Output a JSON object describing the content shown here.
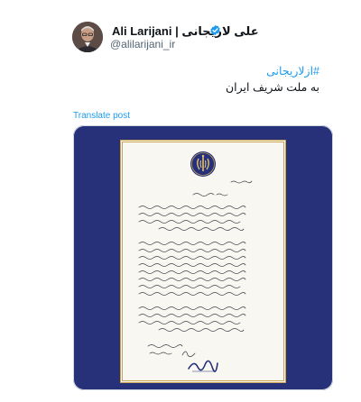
{
  "post": {
    "author": {
      "display_name": "Ali Larijani | علی لاریجانی",
      "handle": "@alilarijani_ir",
      "verified": true
    },
    "hashtag": "#ازلاریجانی",
    "text": "به ملت شریف ایران",
    "translate_label": "Translate post",
    "media": {
      "type": "image",
      "subject": "handwritten-letter",
      "background_color": "#26317a",
      "border_color": "#c9a451"
    }
  },
  "colors": {
    "link": "#1d9bf0",
    "text": "#0f1419",
    "muted": "#536471"
  }
}
